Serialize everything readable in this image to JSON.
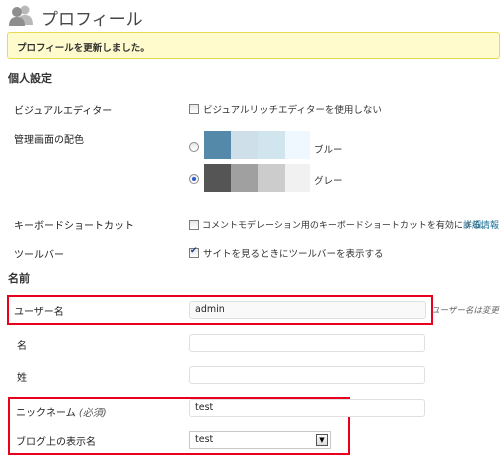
{
  "header": {
    "title": "プロフィール"
  },
  "notice": {
    "text": "プロフィールを更新しました。"
  },
  "personal_settings": {
    "heading": "個人設定",
    "visual_editor": {
      "label": "ビジュアルエディター",
      "checkbox_label": "ビジュアルリッチエディターを使用しない",
      "checked": false
    },
    "admin_color": {
      "label": "管理画面の配色",
      "schemes": [
        {
          "name": "ブルー",
          "selected": false,
          "colors": [
            "#5589aa",
            "#cfdfe9",
            "#d1e5ee",
            "#eff8ff"
          ]
        },
        {
          "name": "グレー",
          "selected": true,
          "colors": [
            "#555555",
            "#a0a0a0",
            "#cccccc",
            "#f1f1f1"
          ]
        }
      ]
    },
    "keyboard_shortcuts": {
      "label": "キーボードショートカット",
      "checkbox_label": "コメントモデレーション用のキーボードショートカットを有効にする。",
      "link": "詳細情報",
      "checked": false
    },
    "toolbar": {
      "label": "ツールバー",
      "checkbox_label": "サイトを見るときにツールバーを表示する",
      "checked": true
    }
  },
  "name_section": {
    "heading": "名前",
    "username": {
      "label": "ユーザー名",
      "value": "admin",
      "hint": "ユーザー名は変更"
    },
    "first_name": {
      "label": "名",
      "value": ""
    },
    "last_name": {
      "label": "姓",
      "value": ""
    },
    "nickname": {
      "label": "ニックネーム",
      "required": "(必須)",
      "value": "test"
    },
    "display_name": {
      "label": "ブログ上の表示名",
      "value": "test"
    }
  },
  "colors": {
    "highlight_box": "#e8001c",
    "link": "#21759b",
    "notice_bg": "#fffbcc"
  }
}
